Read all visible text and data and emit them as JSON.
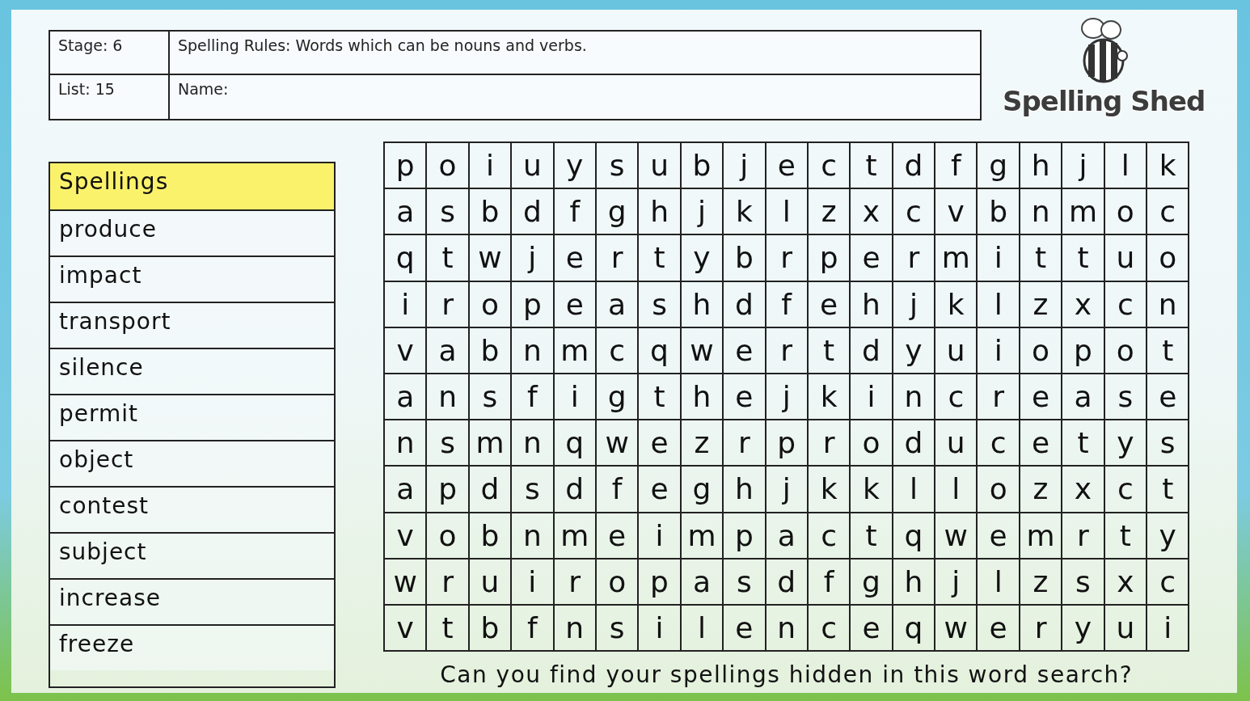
{
  "header": {
    "stage": "Stage: 6",
    "list": "List: 15",
    "rule": "Spelling Rules: Words which can be nouns and verbs.",
    "name_label": "Name:"
  },
  "logo": {
    "text": "Spelling Shed"
  },
  "spellings": {
    "title": "Spellings",
    "words": [
      "produce",
      "impact",
      "transport",
      "silence",
      "permit",
      "object",
      "contest",
      "subject",
      "increase",
      "freeze"
    ]
  },
  "grid": {
    "rows": [
      [
        "p",
        "o",
        "i",
        "u",
        "y",
        "s",
        "u",
        "b",
        "j",
        "e",
        "c",
        "t",
        "d",
        "f",
        "g",
        "h",
        "j",
        "l",
        "k"
      ],
      [
        "a",
        "s",
        "b",
        "d",
        "f",
        "g",
        "h",
        "j",
        "k",
        "l",
        "z",
        "x",
        "c",
        "v",
        "b",
        "n",
        "m",
        "o",
        "c"
      ],
      [
        "q",
        "t",
        "w",
        "j",
        "e",
        "r",
        "t",
        "y",
        "b",
        "r",
        "p",
        "e",
        "r",
        "m",
        "i",
        "t",
        "t",
        "u",
        "o"
      ],
      [
        "i",
        "r",
        "o",
        "p",
        "e",
        "a",
        "s",
        "h",
        "d",
        "f",
        "e",
        "h",
        "j",
        "k",
        "l",
        "z",
        "x",
        "c",
        "n"
      ],
      [
        "v",
        "a",
        "b",
        "n",
        "m",
        "c",
        "q",
        "w",
        "e",
        "r",
        "t",
        "d",
        "y",
        "u",
        "i",
        "o",
        "p",
        "o",
        "t"
      ],
      [
        "a",
        "n",
        "s",
        "f",
        "i",
        "g",
        "t",
        "h",
        "e",
        "j",
        "k",
        "i",
        "n",
        "c",
        "r",
        "e",
        "a",
        "s",
        "e"
      ],
      [
        "n",
        "s",
        "m",
        "n",
        "q",
        "w",
        "e",
        "z",
        "r",
        "p",
        "r",
        "o",
        "d",
        "u",
        "c",
        "e",
        "t",
        "y",
        "s"
      ],
      [
        "a",
        "p",
        "d",
        "s",
        "d",
        "f",
        "e",
        "g",
        "h",
        "j",
        "k",
        "k",
        "l",
        "l",
        "o",
        "z",
        "x",
        "c",
        "t"
      ],
      [
        "v",
        "o",
        "b",
        "n",
        "m",
        "e",
        "i",
        "m",
        "p",
        "a",
        "c",
        "t",
        "q",
        "w",
        "e",
        "m",
        "r",
        "t",
        "y"
      ],
      [
        "w",
        "r",
        "u",
        "i",
        "r",
        "o",
        "p",
        "a",
        "s",
        "d",
        "f",
        "g",
        "h",
        "j",
        "l",
        "z",
        "s",
        "x",
        "c"
      ],
      [
        "v",
        "t",
        "b",
        "f",
        "n",
        "s",
        "i",
        "l",
        "e",
        "n",
        "c",
        "e",
        "q",
        "w",
        "e",
        "r",
        "y",
        "u",
        "i"
      ]
    ]
  },
  "caption": "Can you find your spellings hidden in this word search?"
}
